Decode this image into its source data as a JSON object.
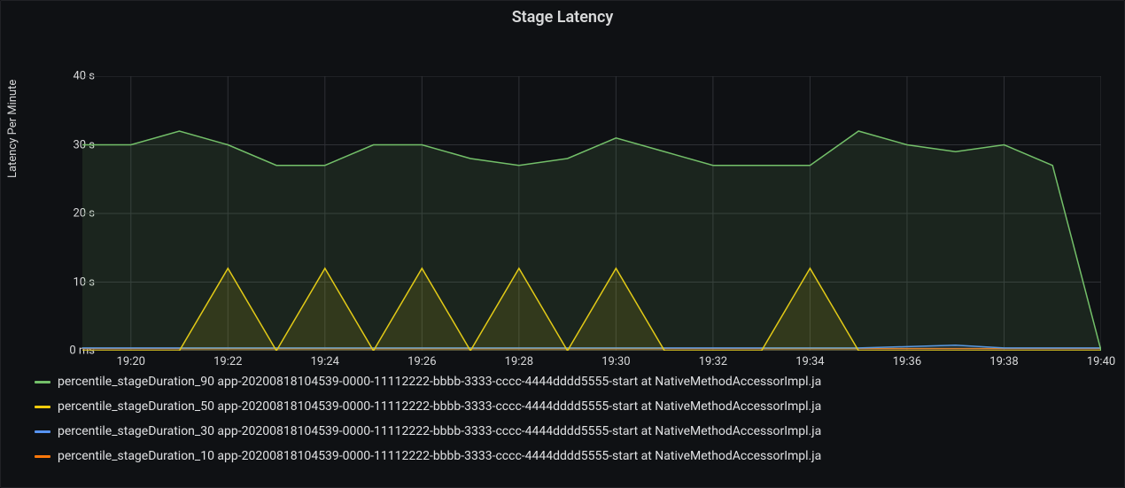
{
  "title": "Stage Latency",
  "ylabel": "Latency Per Minute",
  "legend": [
    "percentile_stageDuration_90 app-20200818104539-0000-11112222-bbbb-3333-cccc-4444dddd5555-start at NativeMethodAccessorImpl.ja",
    "percentile_stageDuration_50 app-20200818104539-0000-11112222-bbbb-3333-cccc-4444dddd5555-start at NativeMethodAccessorImpl.ja",
    "percentile_stageDuration_30 app-20200818104539-0000-11112222-bbbb-3333-cccc-4444dddd5555-start at NativeMethodAccessorImpl.ja",
    "percentile_stageDuration_10 app-20200818104539-0000-11112222-bbbb-3333-cccc-4444dddd5555-start at NativeMethodAccessorImpl.ja"
  ],
  "y_ticks": [
    "0 ms",
    "10 s",
    "20 s",
    "30 s",
    "40 s"
  ],
  "x_ticks": [
    "19:20",
    "19:22",
    "19:24",
    "19:26",
    "19:28",
    "19:30",
    "19:32",
    "19:34",
    "19:36",
    "19:38",
    "19:40"
  ],
  "chart_data": {
    "type": "area",
    "title": "Stage Latency",
    "ylabel": "Latency Per Minute",
    "xlabel": "",
    "ylim": [
      0,
      40
    ],
    "xlim": [
      "19:19",
      "19:40"
    ],
    "x": [
      "19:19",
      "19:20",
      "19:21",
      "19:22",
      "19:23",
      "19:24",
      "19:25",
      "19:26",
      "19:27",
      "19:28",
      "19:29",
      "19:30",
      "19:31",
      "19:32",
      "19:33",
      "19:34",
      "19:35",
      "19:36",
      "19:37",
      "19:38",
      "19:39",
      "19:40"
    ],
    "series": [
      {
        "name": "percentile_stageDuration_90",
        "color": "#73bf69",
        "values": [
          30,
          30,
          32,
          30,
          27,
          27,
          30,
          30,
          28,
          27,
          28,
          31,
          29,
          27,
          27,
          27,
          32,
          30,
          29,
          30,
          27,
          0
        ]
      },
      {
        "name": "percentile_stageDuration_50",
        "color": "#f2cc0c",
        "values": [
          0,
          0,
          0,
          12,
          0,
          12,
          0,
          12,
          0,
          12,
          0,
          12,
          0,
          0,
          0,
          12,
          0,
          0,
          0,
          0,
          0,
          0
        ]
      },
      {
        "name": "percentile_stageDuration_30",
        "color": "#5794f2",
        "values": [
          0.4,
          0.4,
          0.4,
          0.4,
          0.4,
          0.4,
          0.4,
          0.4,
          0.4,
          0.4,
          0.4,
          0.4,
          0.4,
          0.4,
          0.4,
          0.4,
          0.4,
          0.6,
          0.8,
          0.4,
          0.4,
          0.4
        ]
      },
      {
        "name": "percentile_stageDuration_10",
        "color": "#ff780a",
        "values": [
          0.3,
          0.3,
          0.3,
          0.3,
          0.3,
          0.3,
          0.3,
          0.3,
          0.3,
          0.3,
          0.3,
          0.3,
          0.3,
          0.3,
          0.3,
          0.3,
          0.3,
          0.3,
          0.3,
          0.3,
          0.3,
          0.3
        ]
      }
    ]
  }
}
